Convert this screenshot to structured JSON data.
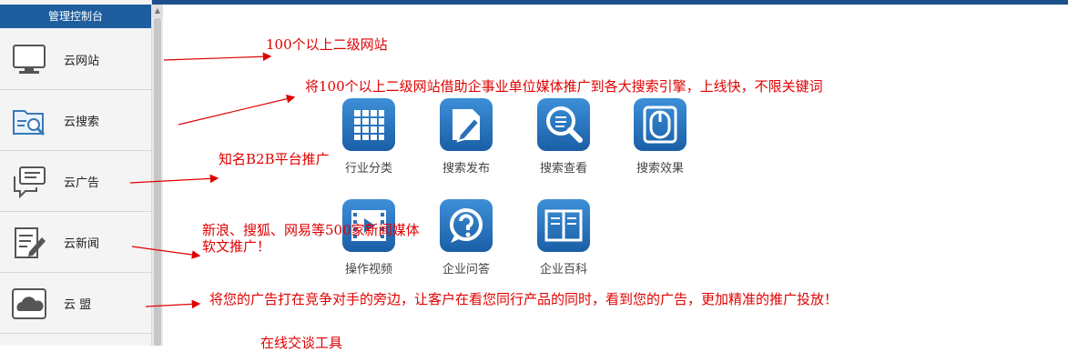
{
  "sidebar": {
    "title": "管理控制台",
    "items": [
      {
        "label": "云网站",
        "icon": "monitor-icon"
      },
      {
        "label": "云搜索",
        "icon": "folder-search-icon"
      },
      {
        "label": "云广告",
        "icon": "chat-bubble-icon"
      },
      {
        "label": "云新闻",
        "icon": "document-edit-icon"
      },
      {
        "label": "云  盟",
        "icon": "cloud-icon"
      }
    ]
  },
  "tiles": [
    {
      "label": "行业分类",
      "icon": "grid-icon"
    },
    {
      "label": "搜索发布",
      "icon": "edit-icon"
    },
    {
      "label": "搜索查看",
      "icon": "magnifier-icon"
    },
    {
      "label": "搜索效果",
      "icon": "mouse-icon"
    },
    {
      "label": "操作视频",
      "icon": "film-icon"
    },
    {
      "label": "企业问答",
      "icon": "question-icon"
    },
    {
      "label": "企业百科",
      "icon": "book-icon"
    }
  ],
  "annotations": {
    "a1": "100个以上二级网站",
    "a2": "将100个以上二级网站借助企事业单位媒体推广到各大搜索引擎，上线快，不限关键词",
    "a3": "知名B2B平台推广",
    "a4": "新浪、搜狐、网易等500家新闻媒体",
    "a4b": "软文推广！",
    "a5": "将您的广告打在竞争对手的旁边，让客户在看您同行产品的同时，看到您的广告，更加精准的推广投放！",
    "a6": "在线交谈工具"
  },
  "colors": {
    "accent": "#1e5e9e",
    "annotation": "#e10000",
    "tile": "#2f7cc6"
  }
}
